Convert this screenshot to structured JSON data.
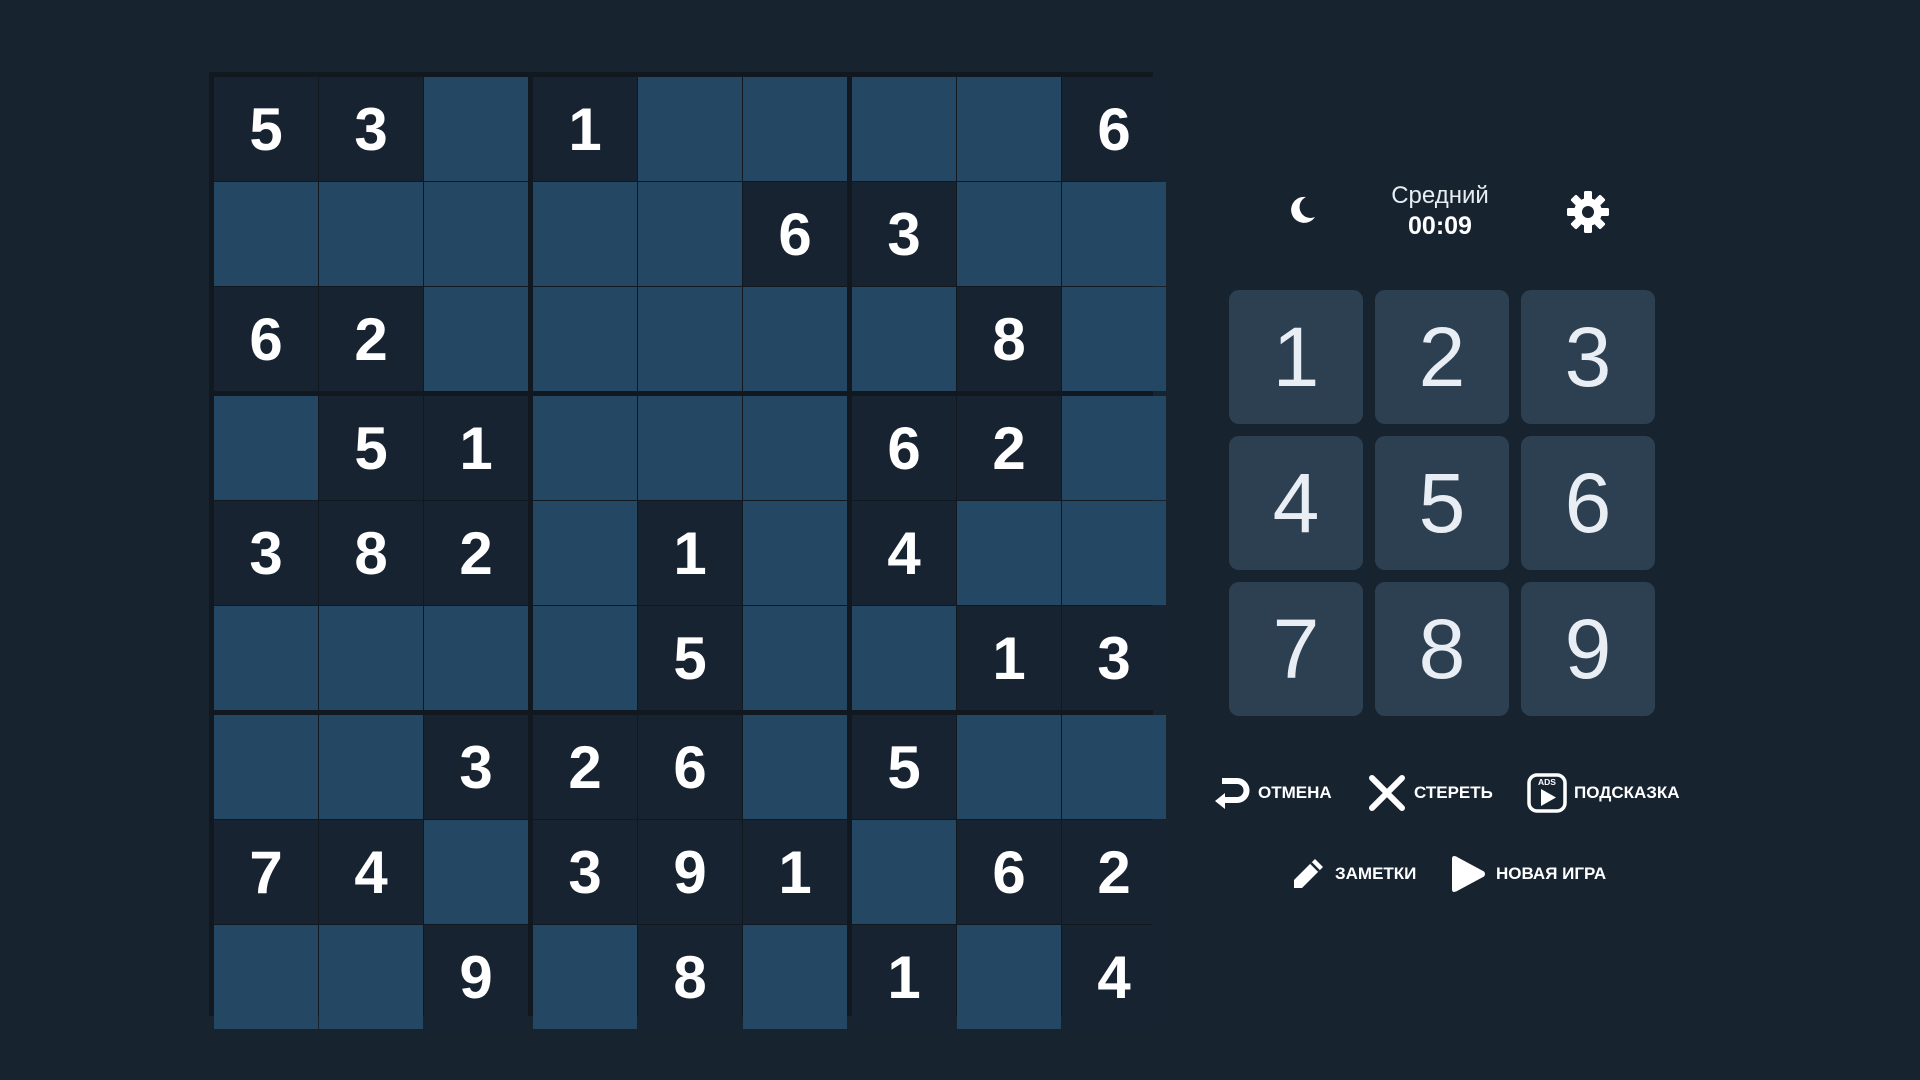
{
  "status": {
    "difficulty": "Средний",
    "timer": "00:09",
    "theme_icon": "moon-icon",
    "settings_icon": "gear-icon"
  },
  "board": {
    "rows": [
      [
        5,
        3,
        0,
        1,
        0,
        0,
        0,
        0,
        6
      ],
      [
        0,
        0,
        0,
        0,
        0,
        6,
        3,
        0,
        0
      ],
      [
        6,
        2,
        0,
        0,
        0,
        0,
        0,
        8,
        0
      ],
      [
        0,
        5,
        1,
        0,
        0,
        0,
        6,
        2,
        0
      ],
      [
        3,
        8,
        2,
        0,
        1,
        0,
        4,
        0,
        0
      ],
      [
        0,
        0,
        0,
        0,
        5,
        0,
        0,
        1,
        3
      ],
      [
        0,
        0,
        3,
        2,
        6,
        0,
        5,
        0,
        0
      ],
      [
        7,
        4,
        0,
        3,
        9,
        1,
        0,
        6,
        2
      ],
      [
        0,
        0,
        9,
        0,
        8,
        0,
        1,
        0,
        4
      ]
    ]
  },
  "numpad": {
    "keys": [
      "1",
      "2",
      "3",
      "4",
      "5",
      "6",
      "7",
      "8",
      "9"
    ]
  },
  "actions": {
    "undo": {
      "label": "ОТМЕНА",
      "icon": "undo-arrow-icon"
    },
    "erase": {
      "label": "СТЕРЕТЬ",
      "icon": "close-x-icon"
    },
    "hint": {
      "label": "ПОДСКАЗКА",
      "icon": "ads-video-icon",
      "badge": "ADS"
    },
    "notes": {
      "label": "ЗАМЕТКИ",
      "icon": "pencil-icon"
    },
    "new_game": {
      "label": "НОВАЯ ИГРА",
      "icon": "play-icon"
    }
  },
  "colors": {
    "background": "#182330",
    "cell_empty": "#244863",
    "cell_given": "#172331",
    "numpad_key": "#2d4052"
  }
}
